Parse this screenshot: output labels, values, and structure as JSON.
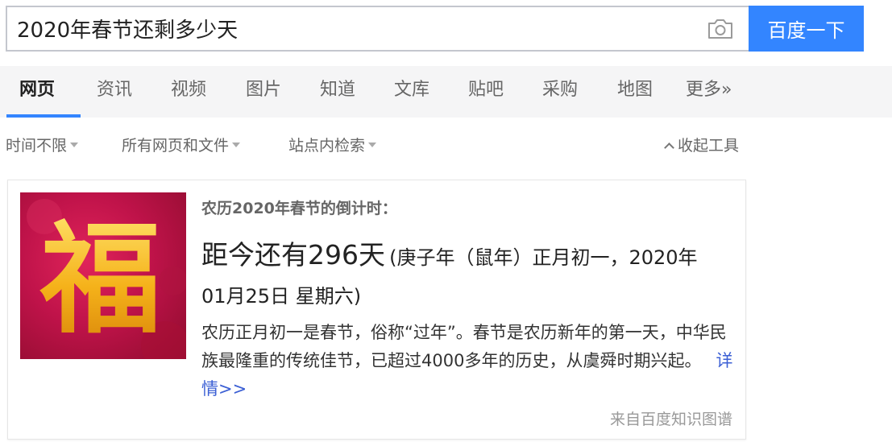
{
  "search": {
    "query": "2020年春节还剩多少天",
    "button_label": "百度一下"
  },
  "tabs": [
    {
      "label": "网页"
    },
    {
      "label": "资讯"
    },
    {
      "label": "视频"
    },
    {
      "label": "图片"
    },
    {
      "label": "知道"
    },
    {
      "label": "文库"
    },
    {
      "label": "贴吧"
    },
    {
      "label": "采购"
    },
    {
      "label": "地图"
    },
    {
      "label": "更多»"
    }
  ],
  "tools": {
    "time_filter": "时间不限",
    "file_filter": "所有网页和文件",
    "site_search": "站点内检索",
    "collapse": "收起工具"
  },
  "card": {
    "image_char": "福",
    "heading": "农历2020年春节的倒计时：",
    "countdown": "距今还有296天",
    "countdown_detail": "(庚子年（鼠年）正月初一，2020年",
    "date_line": "01月25日 星期六)",
    "description": "农历正月初一是春节，俗称“过年”。春节是农历新年的第一天，中华民族最隆重的传统佳节，已超过4000多年的历史，从虞舜时期兴起。",
    "detail_link": "详情>>",
    "source": "来自百度知识图谱"
  },
  "icons": {
    "camera": "camera-icon"
  },
  "colors": {
    "accent": "#3385ff",
    "tab_bar_bg": "#f5f5f6",
    "link": "#3b5fd4",
    "fu_red": "#c0134a",
    "fu_gold": "#f5b21a"
  }
}
